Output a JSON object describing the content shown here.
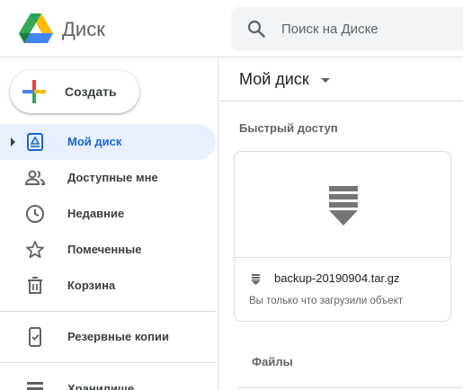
{
  "app": {
    "title": "Диск"
  },
  "search": {
    "placeholder": "Поиск на Диске"
  },
  "sidebar": {
    "create_label": "Создать",
    "items": [
      {
        "label": "Мой диск",
        "icon": "my-drive-icon",
        "active": true
      },
      {
        "label": "Доступные мне",
        "icon": "shared-people-icon"
      },
      {
        "label": "Недавние",
        "icon": "clock-icon"
      },
      {
        "label": "Помеченные",
        "icon": "star-icon"
      },
      {
        "label": "Корзина",
        "icon": "trash-icon"
      },
      {
        "label": "Резервные копии",
        "icon": "backup-device-icon"
      },
      {
        "label": "Хранилище",
        "icon": "storage-icon"
      }
    ]
  },
  "main": {
    "title": "Мой диск",
    "quick_access_title": "Быстрый доступ",
    "quick_file": {
      "name": "backup-20190904.tar.gz",
      "subtitle": "Вы только что загрузили объект"
    },
    "files_title": "Файлы"
  },
  "colors": {
    "accent": "#1967d2",
    "active_bg": "#e8f0fe",
    "icon_gray": "#5f6368",
    "border": "#dadce0"
  }
}
